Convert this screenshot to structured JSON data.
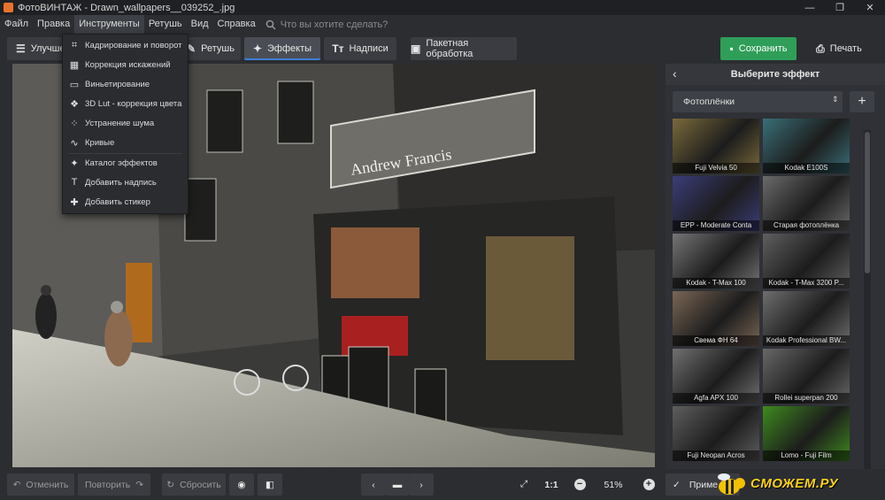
{
  "window": {
    "title": "ФотоВИНТАЖ - Drawn_wallpapers__039252_.jpg",
    "controls": [
      "—",
      "❐",
      "✕"
    ]
  },
  "menu": {
    "items": [
      "Файл",
      "Правка",
      "Инструменты",
      "Ретушь",
      "Вид",
      "Справка"
    ],
    "search_placeholder": "Что вы хотите сделать?"
  },
  "toolbar": {
    "improve_label": "Улучшен",
    "retouch_label": "Ретушь",
    "effects_label": "Эффекты",
    "captions_label": "Надписи",
    "batch_label": "Пакетная обработка",
    "save_label": "Сохранить",
    "print_label": "Печать"
  },
  "tools_menu": {
    "items": [
      {
        "label": "Кадрирование и поворот",
        "icon": "crop-icon"
      },
      {
        "label": "Коррекция искажений",
        "icon": "grid-icon"
      },
      {
        "label": "Виньетирование",
        "icon": "vignette-icon"
      },
      {
        "label": "3D Lut - коррекция цвета",
        "icon": "lut-icon"
      },
      {
        "label": "Устранение шума",
        "icon": "noise-icon"
      },
      {
        "label": "Кривые",
        "icon": "curves-icon"
      },
      {
        "label": "Каталог эффектов",
        "icon": "magic-wand-icon"
      },
      {
        "label": "Добавить надпись",
        "icon": "text-icon"
      },
      {
        "label": "Добавить стикер",
        "icon": "sticker-icon"
      }
    ]
  },
  "photo": {
    "shop_sign": "Andrew Francis"
  },
  "effects_panel": {
    "title": "Выберите эффект",
    "category": "Фотоплёнки",
    "thumbnails": [
      {
        "name": "Fuji Velvia 50",
        "tint": "#7a6a3a"
      },
      {
        "name": "Kodak E100S",
        "tint": "#3a6f78"
      },
      {
        "name": "EPP - Moderate Conta",
        "tint": "#3b3d7a"
      },
      {
        "name": "Старая фотоплёнка",
        "tint": "#6a6a6a"
      },
      {
        "name": "Kodak - T-Max 100",
        "tint": "#757575"
      },
      {
        "name": "Kodak - T-Max 3200 P...",
        "tint": "#5f5f5f"
      },
      {
        "name": "Свема ФН 64",
        "tint": "#7a6655"
      },
      {
        "name": "Kodak Professional BW...",
        "tint": "#6e6e6e"
      },
      {
        "name": "Agfa APX 100",
        "tint": "#707070"
      },
      {
        "name": "Rollei superpan 200",
        "tint": "#686868"
      },
      {
        "name": "Fuji Neopan Acros",
        "tint": "#5e5e5e"
      },
      {
        "name": "Lomo - Fuji Film",
        "tint": "#3f8a1e"
      }
    ],
    "apply_label": "Приме"
  },
  "bottombar": {
    "undo_label": "Отменить",
    "redo_label": "Повторить",
    "reset_label": "Сбросить",
    "ratio_label": "1:1",
    "zoom": "51%",
    "watermark": "СМОЖЕМ.РУ"
  }
}
